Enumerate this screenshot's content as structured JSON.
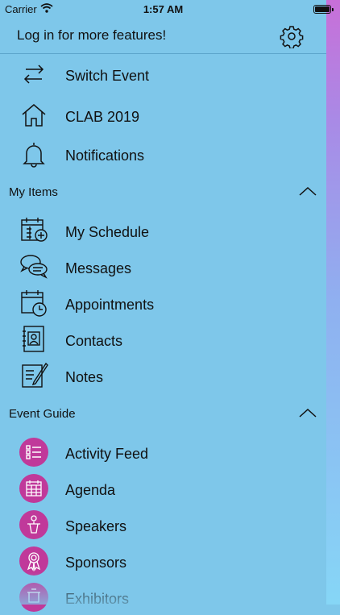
{
  "status": {
    "carrier": "Carrier",
    "time": "1:57 AM"
  },
  "header": {
    "login_text": "Log in for more features!"
  },
  "top_items": [
    {
      "label": "Switch Event",
      "icon": "switch-arrows-icon"
    },
    {
      "label": "CLAB 2019",
      "icon": "home-icon"
    },
    {
      "label": "Notifications",
      "icon": "bell-icon"
    }
  ],
  "my_items": {
    "title": "My Items",
    "items": [
      {
        "label": "My Schedule",
        "icon": "calendar-plus-icon"
      },
      {
        "label": "Messages",
        "icon": "chat-bubbles-icon"
      },
      {
        "label": "Appointments",
        "icon": "calendar-clock-icon"
      },
      {
        "label": "Contacts",
        "icon": "contacts-book-icon"
      },
      {
        "label": "Notes",
        "icon": "note-pencil-icon"
      }
    ]
  },
  "event_guide": {
    "title": "Event Guide",
    "items": [
      {
        "label": "Activity Feed",
        "icon": "list-icon"
      },
      {
        "label": "Agenda",
        "icon": "calendar-grid-icon"
      },
      {
        "label": "Speakers",
        "icon": "speaker-podium-icon"
      },
      {
        "label": "Sponsors",
        "icon": "ribbon-award-icon"
      },
      {
        "label": "Exhibitors",
        "icon": "exhibitor-booth-icon"
      }
    ]
  },
  "colors": {
    "background": "#7ec7ea",
    "accent": "#c0399a",
    "divider": "#5da6cc"
  }
}
